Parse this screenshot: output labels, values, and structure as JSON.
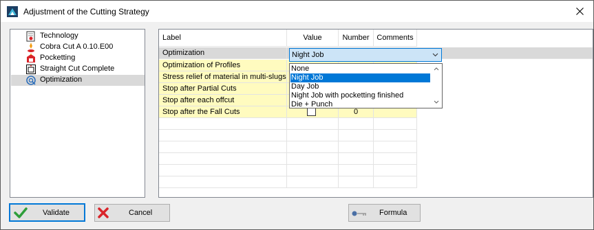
{
  "window": {
    "title": "Adjustment of the Cutting Strategy"
  },
  "tree": {
    "items": [
      {
        "label": "Technology",
        "icon": "technology-icon"
      },
      {
        "label": "Cobra Cut A 0.10.E00",
        "icon": "cobra-cut-icon"
      },
      {
        "label": "Pocketting",
        "icon": "pocketting-icon"
      },
      {
        "label": "Straight Cut Complete",
        "icon": "straight-cut-icon"
      },
      {
        "label": "Optimization",
        "icon": "optimization-icon",
        "selected": true
      }
    ]
  },
  "grid": {
    "columns": [
      "Label",
      "Value",
      "Number",
      "Comments"
    ],
    "rows": [
      {
        "label": "Optimization",
        "value": "Night Job",
        "number": "",
        "comments": ""
      },
      {
        "label": "Optimization of Profiles",
        "value": "",
        "number": "",
        "comments": ""
      },
      {
        "label": "Stress relief of material in multi-slugs",
        "value": "",
        "number": "",
        "comments": ""
      },
      {
        "label": "Stop after Partial Cuts",
        "value": "",
        "number": "",
        "comments": ""
      },
      {
        "label": "Stop after each offcut",
        "value": "",
        "number": "",
        "comments": ""
      },
      {
        "label": "Stop after the Fall Cuts",
        "value": "",
        "number": "0",
        "comments": ""
      }
    ],
    "dropdown": {
      "selected": "Night Job",
      "options": [
        "None",
        "Night Job",
        "Day Job",
        "Night Job with pocketting finished",
        "Die + Punch"
      ]
    }
  },
  "buttons": {
    "validate": "Validate",
    "cancel": "Cancel",
    "formula": "Formula"
  },
  "colors": {
    "selection_blue": "#0078d7",
    "row_yellow": "#fffbbf",
    "validate_green": "#2e9e3a",
    "cancel_red": "#d9242a"
  }
}
